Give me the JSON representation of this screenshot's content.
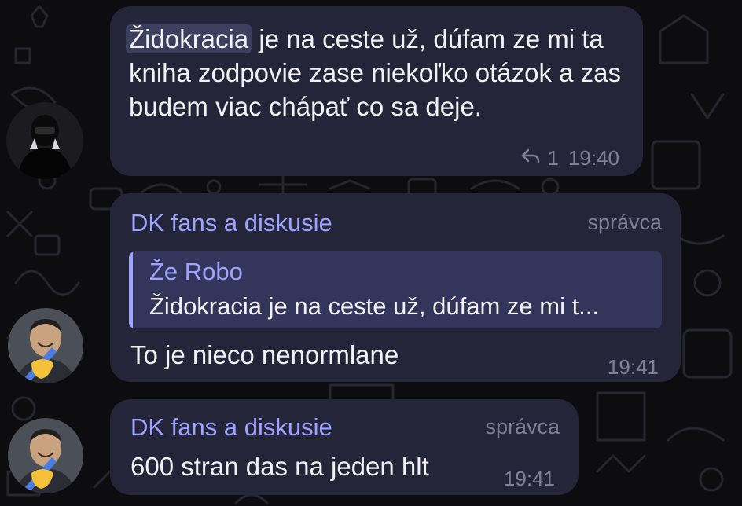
{
  "messages": [
    {
      "highlighted_word": "Židokracia",
      "text_rest": " je na ceste už, dúfam ze mi ta kniha zodpovie zase niekoľko otázok a zas budem viac chápať co sa deje.",
      "replies": "1",
      "time": "19:40"
    },
    {
      "sender": "DK fans a diskusie",
      "role": "správca",
      "quote": {
        "name": "Že Robo",
        "text": "Židokracia je na ceste už, dúfam ze mi t..."
      },
      "text": "To je nieco nenormlane",
      "time": "19:41"
    },
    {
      "sender": "DK fans a diskusie",
      "role": "správca",
      "text": "600 stran das na jeden hlt",
      "time": "19:41"
    }
  ],
  "colors": {
    "background": "#0d0d10",
    "bubble": "#25253a",
    "accent": "#9ea3ff",
    "meta": "#7f8096"
  },
  "icons": {
    "reply": "reply-arrow-icon"
  }
}
